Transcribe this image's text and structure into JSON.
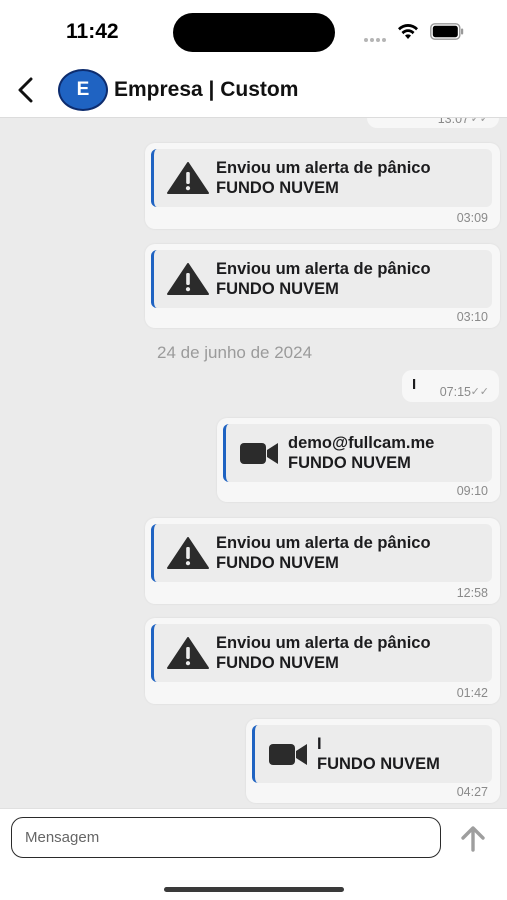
{
  "status_bar": {
    "time": "11:42"
  },
  "header": {
    "avatar_initial": "E",
    "title": "Empresa | Custom"
  },
  "chat": {
    "partial_top_time": "13:07",
    "date_separator": "24 de junho de 2024",
    "small_message": {
      "text": "I",
      "time": "07:15"
    },
    "messages": [
      {
        "icon": "warning-icon",
        "line1": "Enviou um alerta de pânico",
        "line2": "FUNDO NUVEM",
        "time": "03:09"
      },
      {
        "icon": "warning-icon",
        "line1": "Enviou um alerta de pânico",
        "line2": "FUNDO NUVEM",
        "time": "03:10"
      },
      {
        "icon": "video-camera-icon",
        "line1": "demo@fullcam.me",
        "line2": "FUNDO NUVEM",
        "time": "09:10"
      },
      {
        "icon": "warning-icon",
        "line1": "Enviou um alerta de pânico",
        "line2": "FUNDO NUVEM",
        "time": "12:58"
      },
      {
        "icon": "warning-icon",
        "line1": "Enviou um alerta de pânico",
        "line2": "FUNDO NUVEM",
        "time": "01:42"
      },
      {
        "icon": "video-camera-icon",
        "line1": "I",
        "line2": "FUNDO NUVEM",
        "time": "04:27"
      }
    ]
  },
  "input_bar": {
    "placeholder": "Mensagem"
  },
  "colors": {
    "accent": "#1f63c2",
    "chat_background": "#ebebeb",
    "bubble": "#f7f7f7"
  }
}
